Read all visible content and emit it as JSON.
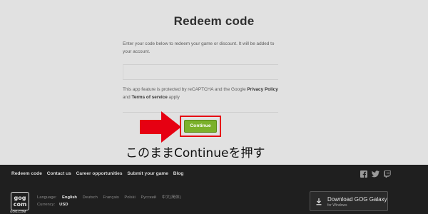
{
  "page": {
    "title": "Redeem code",
    "description": "Enter your code below to redeem your game or discount. It will be added to your account.",
    "code_input": {
      "value": "",
      "placeholder": ""
    },
    "recaptcha": {
      "prefix": "This app feature is protected by reCAPTCHA and the Google ",
      "privacy": "Privacy Policy",
      "and": " and ",
      "terms": "Terms of service",
      "suffix": " apply"
    },
    "continue_label": "Continue"
  },
  "annotation": {
    "caption": "このままContinueを押す",
    "highlight_color": "#e60012"
  },
  "footer": {
    "links": [
      "Redeem code",
      "Contact us",
      "Career opportunities",
      "Submit your game",
      "Blog"
    ],
    "social_icons": [
      "facebook-icon",
      "twitter-icon",
      "twitch-icon"
    ],
    "logo": {
      "top": "gog",
      "bottom": "com",
      "sub": "GOG.COM"
    },
    "language_label": "Language:",
    "languages": [
      "English",
      "Deutsch",
      "Français",
      "Polski",
      "Русский",
      "中文(简体)"
    ],
    "active_language": "English",
    "currency_label": "Currency:",
    "currency_value": "USD",
    "download": {
      "title": "Download GOG Galaxy",
      "subtitle": "for Windows"
    }
  },
  "colors": {
    "continue_button": "#7bb12b",
    "background": "#e1e1e1",
    "footer_background": "#1f1f1f"
  }
}
